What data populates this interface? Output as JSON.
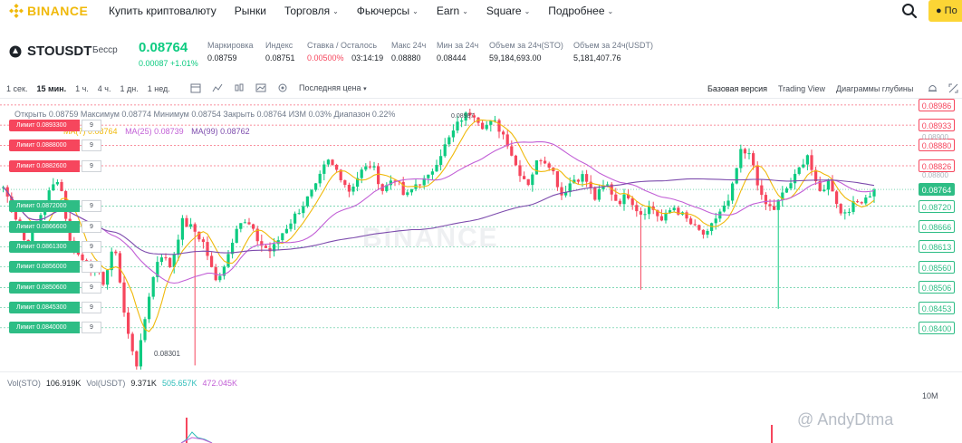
{
  "nav": {
    "logo_text": "BINANCE",
    "items": [
      {
        "label": "Купить криптовалюту",
        "has_menu": false
      },
      {
        "label": "Рынки",
        "has_menu": false
      },
      {
        "label": "Торговля",
        "has_menu": true
      },
      {
        "label": "Фьючерсы",
        "has_menu": true
      },
      {
        "label": "Earn",
        "has_menu": true
      },
      {
        "label": "Square",
        "has_menu": true
      },
      {
        "label": "Подробнее",
        "has_menu": true
      }
    ],
    "cta_label": "По",
    "brand_color": "#f0b90b"
  },
  "ticker": {
    "pair": "STOUSDT",
    "contract_tag": "Бесср",
    "price": "0.08764",
    "change": "0.00087 +1.01%",
    "stats": [
      {
        "label": "Маркировка",
        "value": "0.08759"
      },
      {
        "label": "Индекс",
        "value": "0.08751"
      },
      {
        "label": "Ставка / Осталось",
        "value_red": "0.00500%",
        "value": "03:14:19"
      },
      {
        "label": "Макс 24ч",
        "value": "0.08880"
      },
      {
        "label": "Мин за 24ч",
        "value": "0.08444"
      },
      {
        "label": "Объем за 24ч(STO)",
        "value": "59,184,693.00"
      },
      {
        "label": "Объем за 24ч(USDT)",
        "value": "5,181,407.76"
      }
    ]
  },
  "toolbar": {
    "intervals": [
      "1 сек.",
      "15 мин.",
      "1 ч.",
      "4 ч.",
      "1 дн.",
      "1 нед."
    ],
    "active_interval": "15 мин.",
    "price_type": "Последняя цена",
    "views": [
      "Базовая версия",
      "Trading View",
      "Диаграммы глубины"
    ],
    "active_view": "Базовая версия"
  },
  "chart_legend": {
    "ohlc": "Открыть 0.08759  Максимум 0.08774  Минимум 0.08754  Закрыть 0.08764  ИЗМ 0.03%  Диапазон 0.22%",
    "ma": [
      "MA(7) 0.08764",
      "MA(25) 0.08739",
      "MA(99) 0.08762"
    ]
  },
  "orders": {
    "sell": [
      {
        "label": "Лимит 0.0893300",
        "qty": "9",
        "axis": "0.08933",
        "price": 0.08933
      },
      {
        "label": "Лимит 0.0888000",
        "qty": "9",
        "axis": "0.08880",
        "price": 0.0888
      },
      {
        "label": "Лимит 0.0882600",
        "qty": "9",
        "axis": "0.08826",
        "price": 0.08826
      }
    ],
    "buy": [
      {
        "label": "Лимит 0.0872000",
        "qty": "9",
        "axis": "0.08720",
        "price": 0.0872
      },
      {
        "label": "Лимит 0.0866600",
        "qty": "9",
        "axis": "0.08666",
        "price": 0.08666
      },
      {
        "label": "Лимит 0.0861300",
        "qty": "9",
        "axis": "0.08613",
        "price": 0.08613
      },
      {
        "label": "Лимит 0.0856000",
        "qty": "9",
        "axis": "0.08560",
        "price": 0.0856
      },
      {
        "label": "Лимит 0.0850600",
        "qty": "9",
        "axis": "0.08506",
        "price": 0.08506
      },
      {
        "label": "Лимит 0.0845300",
        "qty": "9",
        "axis": "0.08453",
        "price": 0.08453
      },
      {
        "label": "Лимит 0.0840000",
        "qty": "9",
        "axis": "0.08400",
        "price": 0.084
      }
    ],
    "top_axis": {
      "axis": "0.08986",
      "price": 0.08986
    },
    "current": {
      "axis": "0.08764",
      "price": 0.08764
    },
    "extra_ticks": [
      "0.08900",
      "0.08800"
    ]
  },
  "chart_data": {
    "type": "candlestick",
    "ylim": [
      0.0829,
      0.09
    ],
    "low_marker": "0.08301",
    "high_marker": "0.08987",
    "up_color": "#0ecb81",
    "down_color": "#f6465d",
    "ma_colors": {
      "ma7": "#f0b90b",
      "ma25": "#c25fd6",
      "ma99": "#7d4cad"
    },
    "watermark": "BINANCE",
    "close_path": [
      0.0877,
      0.087,
      0.0862,
      0.0867,
      0.0875,
      0.088,
      0.0862,
      0.0858,
      0.0856,
      0.0852,
      0.0862,
      0.084,
      0.083,
      0.0848,
      0.086,
      0.0856,
      0.0868,
      0.0866,
      0.0862,
      0.0852,
      0.0858,
      0.0868,
      0.0867,
      0.0862,
      0.086,
      0.0865,
      0.0869,
      0.0873,
      0.0877,
      0.0884,
      0.0881,
      0.0876,
      0.0881,
      0.0883,
      0.0876,
      0.088,
      0.0874,
      0.0878,
      0.0879,
      0.0885,
      0.089,
      0.0895,
      0.0897,
      0.0893,
      0.0894,
      0.089,
      0.0882,
      0.0878,
      0.0885,
      0.0883,
      0.0875,
      0.0879,
      0.088,
      0.0874,
      0.0878,
      0.0873,
      0.0875,
      0.087,
      0.0872,
      0.0868,
      0.0872,
      0.0869,
      0.0866,
      0.0864,
      0.087,
      0.0873,
      0.0886,
      0.0885,
      0.0873,
      0.0871,
      0.0876,
      0.088,
      0.0886,
      0.0875,
      0.0879,
      0.087,
      0.0872,
      0.0874,
      0.0876
    ]
  },
  "volume": {
    "labels": [
      "Vol(STO)",
      "106.919K",
      "Vol(USDT)",
      "9.371K"
    ],
    "ma5": "505.657K",
    "ma10": "472.045K",
    "axis_label": "10M"
  },
  "credit": "@ AndyDtma"
}
